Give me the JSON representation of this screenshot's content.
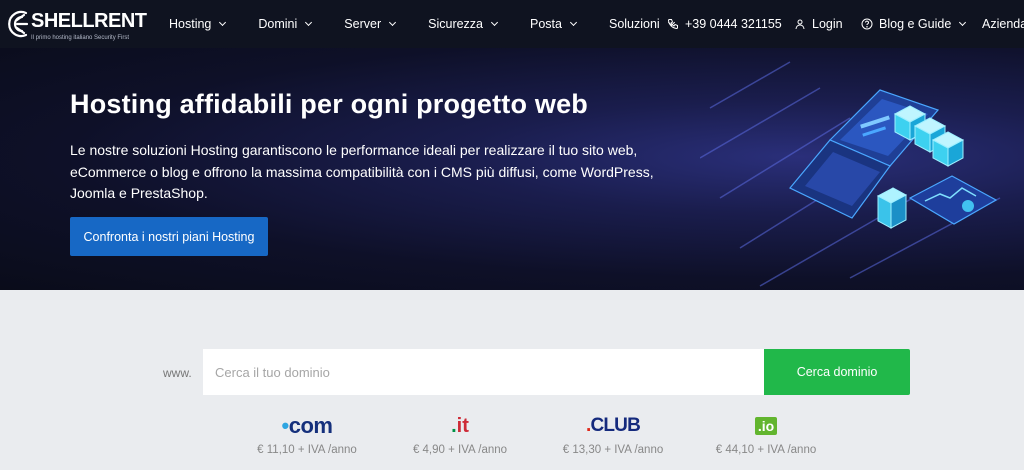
{
  "brand": {
    "name": "SHELLRENT",
    "tagline": "Il primo hosting italiano Security First"
  },
  "nav": {
    "items": [
      {
        "label": "Hosting"
      },
      {
        "label": "Domini"
      },
      {
        "label": "Server"
      },
      {
        "label": "Sicurezza"
      },
      {
        "label": "Posta"
      },
      {
        "label": "Soluzioni"
      }
    ],
    "phone": "+39 0444 321155",
    "login": "Login",
    "blog": "Blog e Guide",
    "company": "Azienda"
  },
  "hero": {
    "title": "Hosting affidabili per ogni progetto web",
    "description": "Le nostre soluzioni Hosting garantiscono le performance ideali per realizzare il tuo sito web, eCommerce o blog e offrono la massima compatibilità con i CMS più diffusi, come WordPress, Joomla e PrestaShop.",
    "cta": "Confronta i nostri piani Hosting"
  },
  "search": {
    "prefix": "www.",
    "placeholder": "Cerca il tuo dominio",
    "button": "Cerca dominio"
  },
  "tlds": [
    {
      "name": ".com",
      "price": "€ 11,10 + IVA /anno"
    },
    {
      "name": ".it",
      "price": "€ 4,90 + IVA /anno"
    },
    {
      "name": ".CLUB",
      "price": "€ 13,30 + IVA /anno"
    },
    {
      "name": ".io",
      "price": "€ 44,10 + IVA /anno"
    }
  ],
  "colors": {
    "nav_bg": "#0f1320",
    "primary_button": "#1768c5",
    "search_button": "#21b84a",
    "page_bg": "#eaecef"
  }
}
